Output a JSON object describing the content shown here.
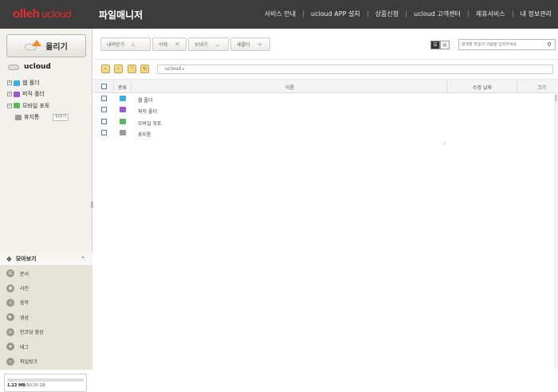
{
  "app": {
    "logo_text": "olleh",
    "logo_sub": "ucloud",
    "title": "파일매니저"
  },
  "topnav": [
    "서비스 안내",
    "ucloud APP 설치",
    "상품신청",
    "ucloud 고객센터",
    "제휴서비스",
    "내 정보관리"
  ],
  "sidebar": {
    "upload_label": "올리기",
    "root_label": "ucloud",
    "tree": [
      {
        "label": "웹 폴더",
        "icon": "web-folder-icon",
        "color": "#3bb0e6",
        "expandable": true
      },
      {
        "label": "퍼직 폴더",
        "icon": "music-folder-icon",
        "color": "#9b59d0",
        "expandable": true
      },
      {
        "label": "모바일 포토",
        "icon": "mobile-photo-icon",
        "color": "#5cb85c",
        "expandable": true
      },
      {
        "label": "휴지통",
        "icon": "trash-icon",
        "color": "#9a9a9a",
        "expandable": false
      }
    ],
    "empty_trash_label": "비우기",
    "collect_title": "모아보기",
    "collect_items": [
      {
        "label": "문서",
        "icon": "document-icon"
      },
      {
        "label": "사진",
        "icon": "photo-icon"
      },
      {
        "label": "음악",
        "icon": "music-icon"
      },
      {
        "label": "영상",
        "icon": "video-icon"
      },
      {
        "label": "인코딩 영상",
        "icon": "encoded-video-icon"
      },
      {
        "label": "태그",
        "icon": "tag-icon"
      },
      {
        "label": "파일링크",
        "icon": "file-link-icon"
      }
    ],
    "storage": {
      "used": "1.22 MB",
      "total": "/50.00 GB",
      "used_fraction": 0.0
    }
  },
  "toolbar": {
    "download_label": "내려받기",
    "delete_label": "삭제",
    "send_label": "보내기",
    "new_folder_label": "새폴더",
    "search_placeholder": "검색할 파일의 이름을 입력하세요"
  },
  "breadcrumb": {
    "path": "ucloud"
  },
  "table": {
    "headers": {
      "type": "종류",
      "name": "이름",
      "modified": "수정 날짜",
      "size": "크기"
    },
    "rows": [
      {
        "name": "웹 폴더",
        "icon": "web-folder-icon",
        "color": "#3bb0e6"
      },
      {
        "name": "퍼직 폴더",
        "icon": "music-folder-icon",
        "color": "#9b59d0"
      },
      {
        "name": "모바일 포토",
        "icon": "mobile-photo-icon",
        "color": "#5cb85c"
      },
      {
        "name": "휴지통",
        "icon": "trash-icon",
        "color": "#9a9a9a"
      }
    ]
  },
  "colors": {
    "topbar": "#3c3c3c",
    "logo": "#e62e2e",
    "nav_button": "#f5d78a",
    "sidebar_bg": "#f3f1ec"
  }
}
